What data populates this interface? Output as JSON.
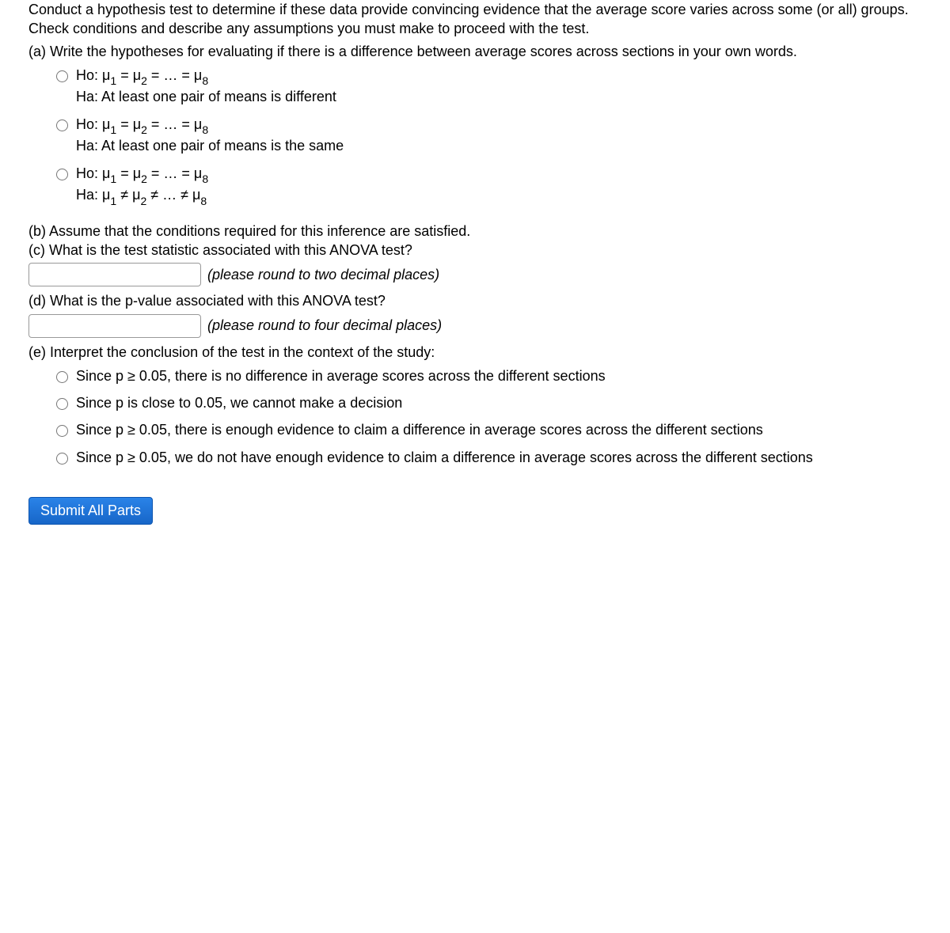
{
  "intro": "Conduct a hypothesis test to determine if these data provide convincing evidence that the average score varies across some (or all) groups. Check conditions and describe any assumptions you must make to proceed with the test.",
  "part_a": {
    "prompt": "(a) Write the hypotheses for evaluating if there is a difference between average scores across sections in your own words.",
    "options": [
      {
        "ho": "Ho: μ₁ = μ₂ = … = μ₈",
        "ha": "Ha: At least one pair of means is different"
      },
      {
        "ho": "Ho: μ₁ = μ₂ = … = μ₈",
        "ha": "Ha: At least one pair of means is the same"
      },
      {
        "ho": "Ho: μ₁ = μ₂ = … = μ₈",
        "ha": "Ha: μ₁ ≠ μ₂ ≠ … ≠ μ₈"
      }
    ]
  },
  "part_b": "(b) Assume that the conditions required for this inference are satisfied.",
  "part_c": {
    "prompt": "(c) What is the test statistic associated with this ANOVA test?",
    "hint": "(please round to two decimal places)",
    "value": ""
  },
  "part_d": {
    "prompt": "(d) What is the p-value associated with this ANOVA test?",
    "hint": "(please round to four decimal places)",
    "value": ""
  },
  "part_e": {
    "prompt": "(e) Interpret the conclusion of the test in the context of the study:",
    "options": [
      "Since p ≥ 0.05, there is no difference in average scores across the different sections",
      "Since p is close to 0.05, we cannot make a decision",
      "Since p ≥ 0.05, there is enough evidence to claim a difference in average scores across the different sections",
      "Since p ≥ 0.05, we do not have enough evidence to claim a difference in average scores across the different sections"
    ]
  },
  "submit_label": "Submit All Parts"
}
